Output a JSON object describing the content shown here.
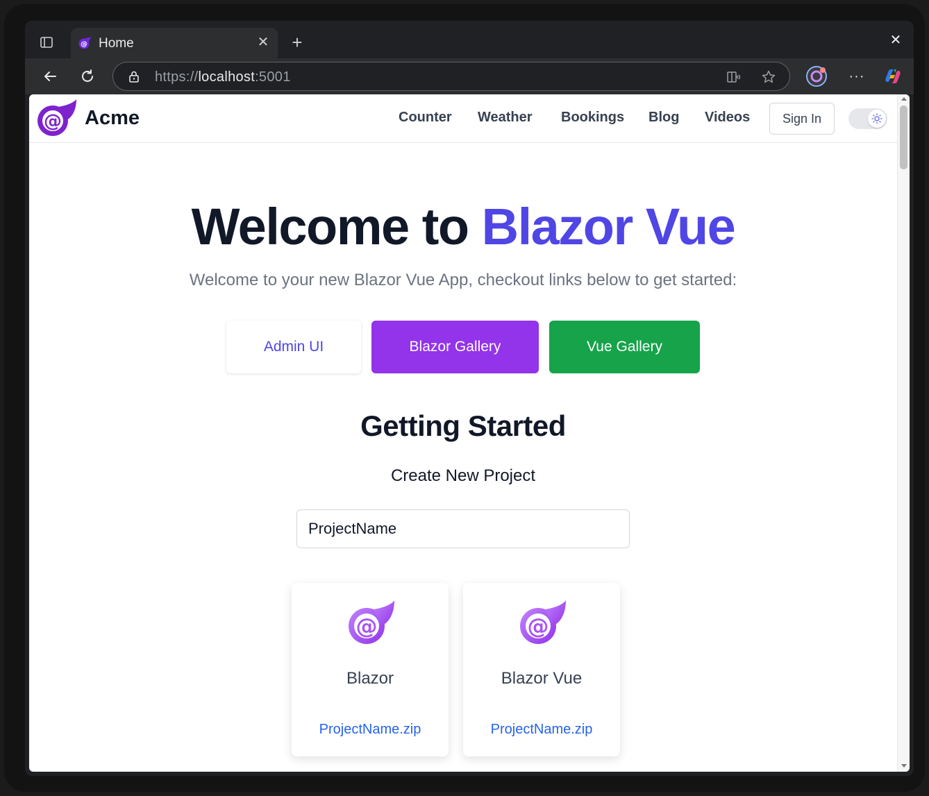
{
  "browser": {
    "tab_title": "Home",
    "url_scheme": "https://",
    "url_host": "localhost",
    "url_port": ":5001"
  },
  "site": {
    "brand": "Acme",
    "nav": [
      "Counter",
      "Weather",
      "Bookings",
      "Blog",
      "Videos"
    ],
    "signin_label": "Sign In"
  },
  "hero": {
    "title_main": "Welcome to ",
    "title_accent": "Blazor Vue",
    "subtitle": "Welcome to your new Blazor Vue App, checkout links below to get started:"
  },
  "buttons": {
    "admin": "Admin UI",
    "blazor_gallery": "Blazor Gallery",
    "vue_gallery": "Vue Gallery"
  },
  "getting_started": {
    "title": "Getting Started",
    "subtitle": "Create New Project",
    "project_name_value": "ProjectName"
  },
  "templates": [
    {
      "name": "Blazor",
      "download": "ProjectName.zip"
    },
    {
      "name": "Blazor Vue",
      "download": "ProjectName.zip"
    }
  ],
  "colors": {
    "accent": "#4f46e5",
    "blazor_purple": "#9333ea",
    "vue_green": "#16a34a",
    "link_blue": "#2563eb"
  }
}
